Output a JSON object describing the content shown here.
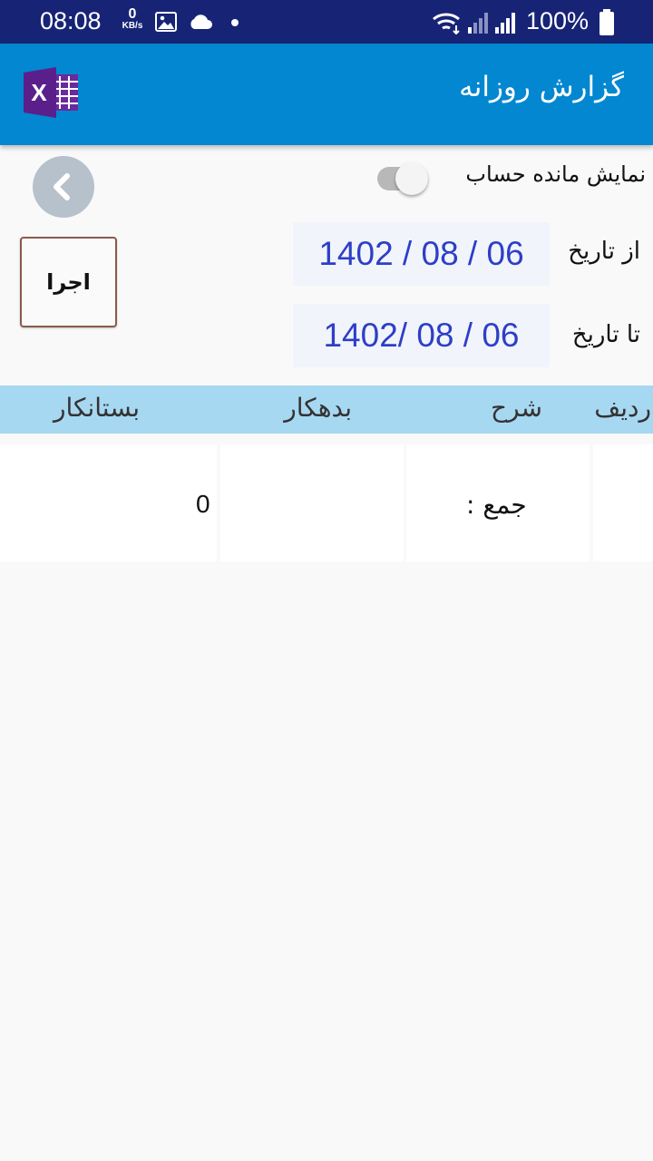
{
  "status_bar": {
    "time": "08:08",
    "net_speed": "0",
    "net_unit": "KB/s",
    "battery": "100%",
    "icons": [
      "gallery-icon",
      "cloud-icon",
      "dot-icon",
      "wifi-icon",
      "signal-icon",
      "signal-icon",
      "battery-icon"
    ]
  },
  "app_bar": {
    "title": "گزارش روزانه",
    "excel_icon": "X"
  },
  "filters": {
    "show_balance_label": "نمایش مانده حساب",
    "from_label": "از تاریخ",
    "from_date": "1402 / 08 / 06",
    "to_label": "تا تاریخ",
    "to_date": "1402/ 08 / 06",
    "run_label": "اجرا"
  },
  "table": {
    "headers": [
      "ردیف",
      "شرح",
      "بدهکار",
      "بستانکار"
    ],
    "total_row": {
      "description": "جمع :",
      "debit": "",
      "credit": "0"
    }
  },
  "colors": {
    "status_bar": "#172476",
    "app_bar": "#0287d0",
    "header_row": "#a7d8f2",
    "date_text": "#2d3fc6"
  }
}
